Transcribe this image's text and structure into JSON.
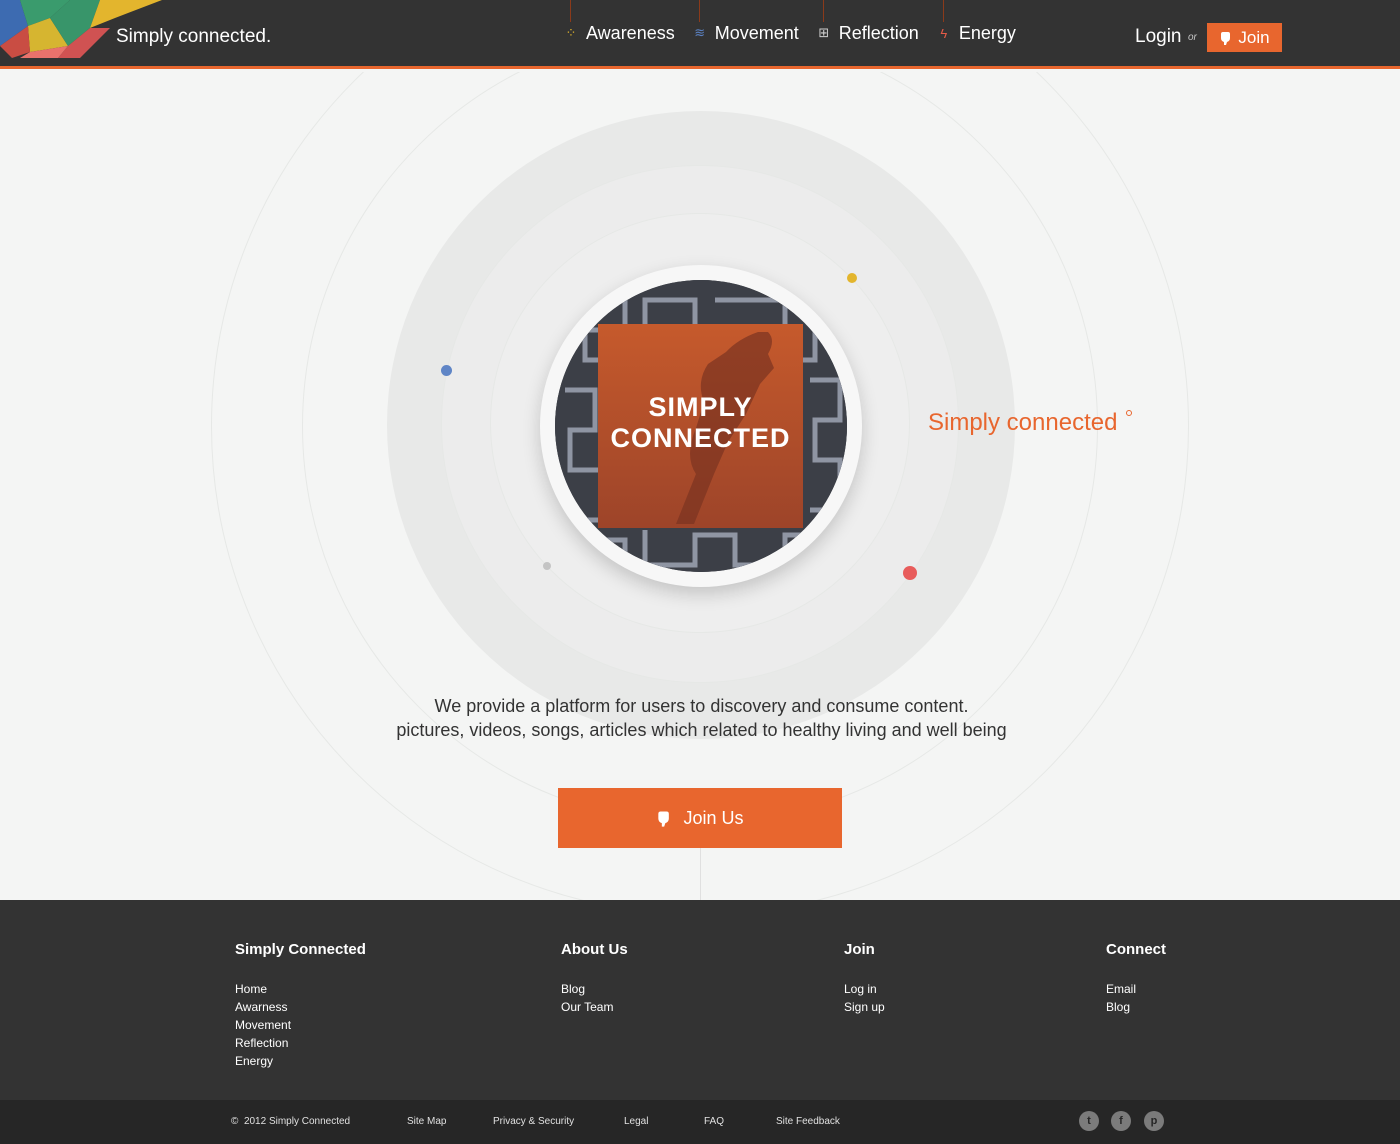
{
  "header": {
    "brand": "Simply connected.",
    "nav": [
      {
        "label": "Awareness",
        "icon": "dots-icon",
        "icon_color": "#e1b52c"
      },
      {
        "label": "Movement",
        "icon": "wave-icon",
        "icon_color": "#5b82c4"
      },
      {
        "label": "Reflection",
        "icon": "grid-icon",
        "icon_color": "#cfcfcf"
      },
      {
        "label": "Energy",
        "icon": "lightning-icon",
        "icon_color": "#e55b48"
      }
    ],
    "login": "Login",
    "or": "or",
    "join": "Join"
  },
  "hero": {
    "image_text": "SIMPLY CONNECTED",
    "tagline": "Simply connected",
    "description_line1": "We provide a platform for users to discovery and consume content.",
    "description_line2": "pictures, videos, songs, articles which related to healthy living and well being",
    "cta": "Join Us",
    "dot_colors": {
      "blue": "#5f85c6",
      "yellow": "#e3b52d",
      "red": "#e85c5b",
      "grey": "#c4c4c4"
    }
  },
  "footer": {
    "columns": [
      {
        "heading": "Simply Connected",
        "links": [
          "Home",
          "Awarness",
          "Movement",
          "Reflection",
          "Energy"
        ]
      },
      {
        "heading": "About Us",
        "links": [
          "Blog",
          "Our Team"
        ]
      },
      {
        "heading": "Join",
        "links": [
          "Log in",
          "Sign up"
        ]
      },
      {
        "heading": "Connect",
        "links": [
          "Email",
          "Blog"
        ]
      }
    ]
  },
  "bottom": {
    "copyright": "2012 Simply Connected",
    "links": [
      "Site Map",
      "Privacy & Security",
      "Legal",
      "FAQ",
      "Site Feedback"
    ],
    "social": [
      "twitter-icon",
      "facebook-icon",
      "pinterest-icon"
    ]
  },
  "colors": {
    "accent": "#e8662e",
    "dark": "#333333",
    "darker": "#262626"
  }
}
